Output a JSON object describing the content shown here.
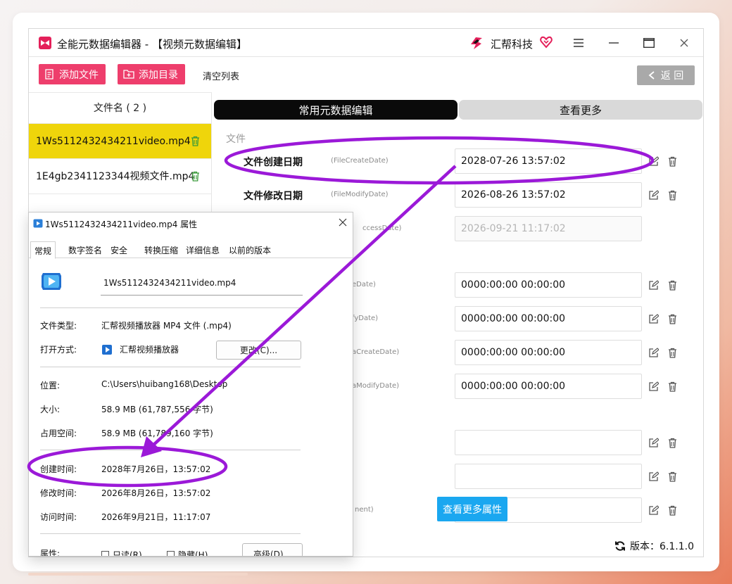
{
  "app": {
    "title": "全能元数据编辑器 - 【视频元数据编辑】",
    "brand": "汇帮科技"
  },
  "toolbar": {
    "add_file": "添加文件",
    "add_dir": "添加目录",
    "clear_list": "清空列表",
    "back": "返 回",
    "back_icon": "chevron-left-icon"
  },
  "filelist": {
    "header": "文件名 ( 2 )",
    "files": [
      {
        "name": "1Ws5112432434211video.mp4",
        "selected": true
      },
      {
        "name": "1E4gb2341123344视频文件.mp4",
        "selected": false
      }
    ]
  },
  "tabs": {
    "active": "常用元数据编辑",
    "inactive": "查看更多"
  },
  "editor": {
    "section": "文件",
    "fields": [
      {
        "label": "文件创建日期",
        "key": "(FileCreateDate)",
        "value": "2028-07-26 13:57:02",
        "editable": true
      },
      {
        "label": "文件修改日期",
        "key": "(FileModifyDate)",
        "value": "2026-08-26 13:57:02",
        "editable": true
      },
      {
        "label": "",
        "key": "ccessDate)",
        "value": "2026-09-21 11:17:02",
        "editable": false
      },
      {
        "label": "",
        "key": "eDate)",
        "value": "0000:00:00 00:00:00",
        "editable": true
      },
      {
        "label": "",
        "key": "fyDate)",
        "value": "0000:00:00 00:00:00",
        "editable": true
      },
      {
        "label": "",
        "key": "aCreateDate)",
        "value": "0000:00:00 00:00:00",
        "editable": true
      },
      {
        "label": "",
        "key": "aModifyDate)",
        "value": "0000:00:00 00:00:00",
        "editable": true
      },
      {
        "label": "",
        "key": "",
        "value": "",
        "editable": true
      },
      {
        "label": "",
        "key": ")",
        "value": "",
        "editable": true
      },
      {
        "label": "",
        "key": "nent)",
        "value": "",
        "editable": true
      }
    ],
    "more_button": "查看更多属性",
    "version": "版本：6.1.1.0"
  },
  "dialog": {
    "title": "1Ws5112432434211video.mp4 属性",
    "tabs": [
      "常规",
      "数字签名",
      "安全",
      "转换压缩",
      "详细信息",
      "以前的版本"
    ],
    "filename": "1Ws5112432434211video.mp4",
    "type_label": "文件类型:",
    "type_value": "汇帮视频播放器 MP4 文件 (.mp4)",
    "open_label": "打开方式:",
    "open_value": "汇帮视频播放器",
    "change_button": "更改(C)...",
    "location_label": "位置:",
    "location_value": "C:\\Users\\huibang168\\Desktop",
    "size_label": "大小:",
    "size_value": "58.9 MB (61,787,556 字节)",
    "disk_label": "占用空间:",
    "disk_value": "58.9 MB (61,789,160 字节)",
    "created_label": "创建时间:",
    "created_value": "2028年7月26日，13:57:02",
    "modified_label": "修改时间:",
    "modified_value": "2026年8月26日，13:57:02",
    "accessed_label": "访问时间:",
    "accessed_value": "2026年9月21日，11:17:07",
    "attr_label": "属性:",
    "readonly": "只读(R)",
    "hidden": "隐藏(H)",
    "advanced_button": "高级(D)..."
  },
  "colors": {
    "accent_pink": "#ee3e6c",
    "selected_yellow": "#efd50b",
    "annotation_purple": "#9b19d8",
    "more_blue": "#1aa7f0"
  }
}
